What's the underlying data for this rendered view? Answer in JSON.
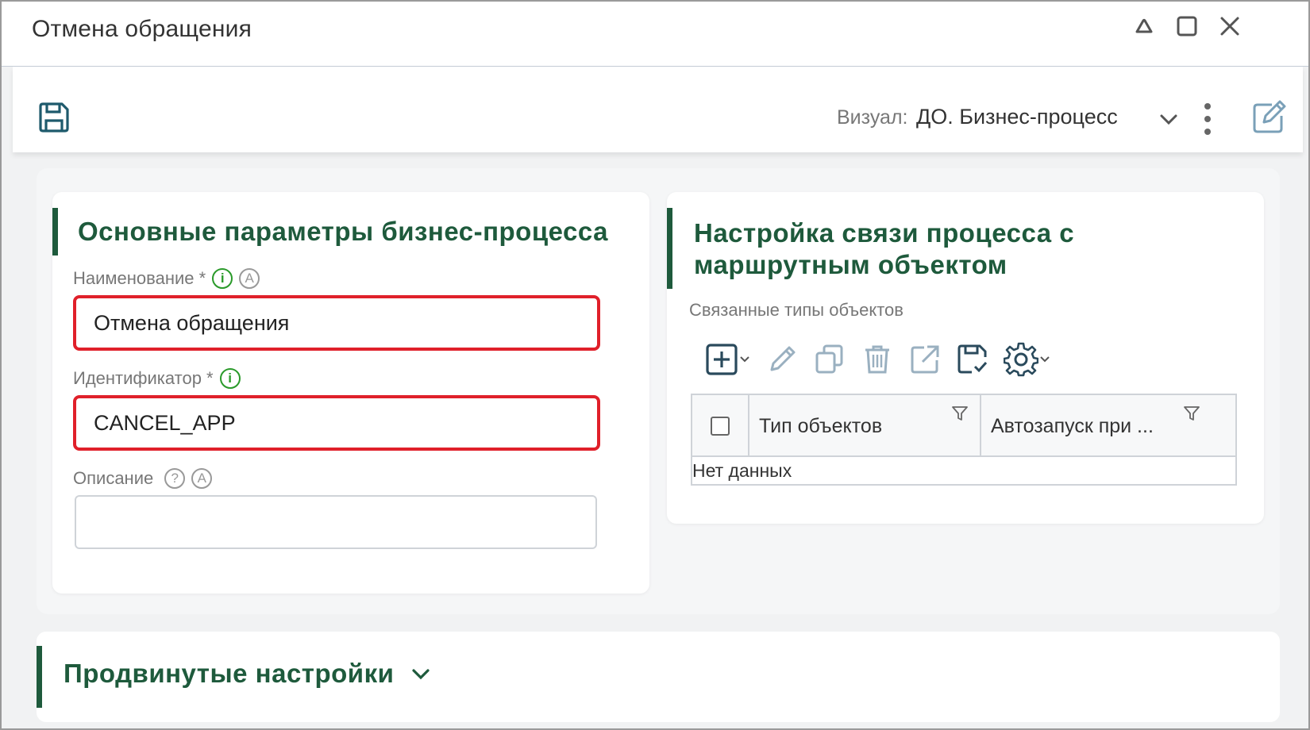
{
  "window": {
    "title": "Отмена обращения"
  },
  "toolbar": {
    "visual_label": "Визуал:",
    "visual_value": "ДО. Бизнес-процесс"
  },
  "main_params": {
    "title": "Основные параметры бизнес-процесса",
    "name_label": "Наименование *",
    "name_value": "Отмена обращения",
    "id_label": "Идентификатор *",
    "id_value": "CANCEL_APP",
    "desc_label": "Описание",
    "desc_value": "",
    "info_glyph": "i",
    "auto_glyph": "A",
    "help_glyph": "?"
  },
  "route_link": {
    "title_line1": "Настройка связи процесса с",
    "title_line2": "маршрутным объектом",
    "linked_types_label": "Связанные типы объектов",
    "columns": [
      "Тип объектов",
      "Автозапуск при ..."
    ],
    "empty_text": "Нет данных"
  },
  "advanced": {
    "title": "Продвинутые настройки"
  },
  "colors": {
    "accent_green": "#1e5a3c",
    "error_red": "#e0202a",
    "info_green": "#2a9a2a"
  }
}
